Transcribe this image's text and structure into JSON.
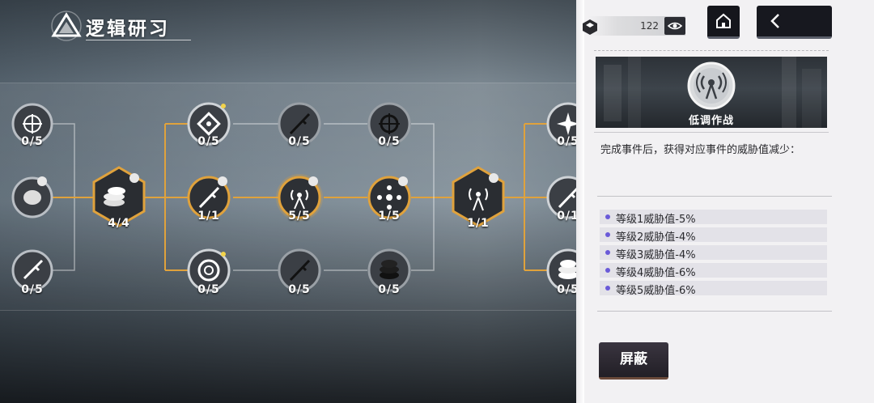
{
  "header": {
    "title": "逻辑研习",
    "logo_icon": "triangle-logo-icon"
  },
  "tree": {
    "connector_color": "#e0a23c",
    "nodes": [
      {
        "id": "L1",
        "label": "0/5",
        "icon": "crosshair-icon"
      },
      {
        "id": "L2",
        "label": "",
        "icon": "coin-icon"
      },
      {
        "id": "L3",
        "label": "0/5",
        "icon": "rifle-icon"
      },
      {
        "id": "hub1",
        "label": "4/4",
        "icon": "coin-stack-icon"
      },
      {
        "id": "A1",
        "label": "0/5",
        "icon": "target-icon"
      },
      {
        "id": "A2",
        "label": "1/1",
        "icon": "rifle-icon"
      },
      {
        "id": "A3",
        "label": "0/5",
        "icon": "ring-icon"
      },
      {
        "id": "B1",
        "label": "0/5",
        "icon": "rifle-icon"
      },
      {
        "id": "B2",
        "label": "5/5",
        "icon": "radio-tower-icon"
      },
      {
        "id": "B3",
        "label": "0/5",
        "icon": "rifle-icon"
      },
      {
        "id": "C1",
        "label": "0/5",
        "icon": "crosshair-icon"
      },
      {
        "id": "C2",
        "label": "1/5",
        "icon": "disperse-icon"
      },
      {
        "id": "C3",
        "label": "0/5",
        "icon": "coin-stack-icon"
      },
      {
        "id": "hub2",
        "label": "1/1",
        "icon": "radio-tower-icon"
      },
      {
        "id": "R1",
        "label": "0/5",
        "icon": "compass-icon"
      },
      {
        "id": "R2",
        "label": "0/1",
        "icon": "rifle-icon"
      },
      {
        "id": "R3",
        "label": "0/5",
        "icon": "coin-stack-icon"
      }
    ]
  },
  "topbar": {
    "resource_count": "122",
    "resource_icon": "cube-icon",
    "eye_icon": "eye-icon",
    "home_icon": "home-icon",
    "back_icon": "chevron-left-icon"
  },
  "detail": {
    "name": "低调作战",
    "icon": "radio-tower-icon",
    "description": "完成事件后，获得对应事件的威胁值减少：",
    "levels": [
      "等级1威胁值-5%",
      "等级2威胁值-4%",
      "等级3威胁值-4%",
      "等级4威胁值-6%",
      "等级5威胁值-6%"
    ],
    "block_button": "屏蔽"
  },
  "colors": {
    "accent": "#e0a23c",
    "panel_bg": "#f2f1f3",
    "bullet": "#6a5ad8"
  }
}
